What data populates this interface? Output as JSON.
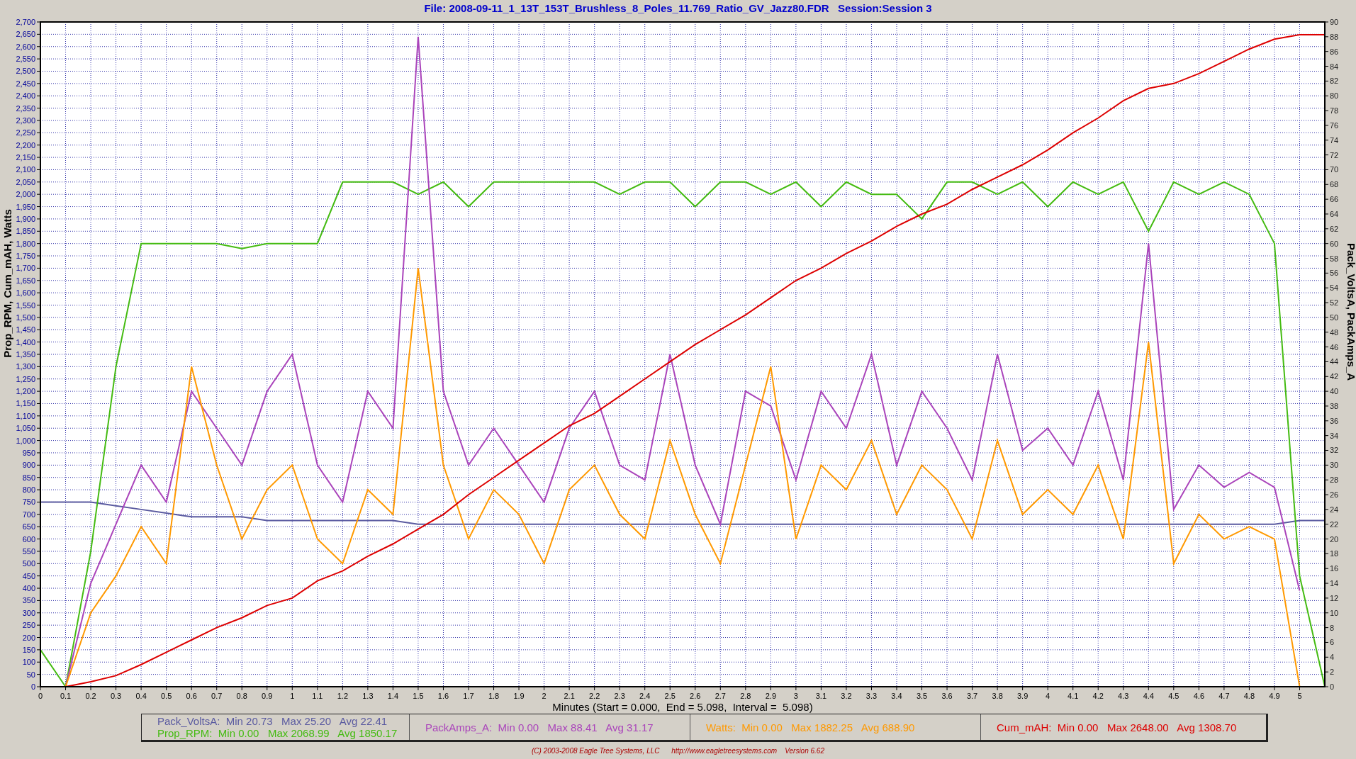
{
  "title": "File: 2008-09-11_1_13T_153T_Brushless_8_Poles_11.769_Ratio_GV_Jazz80.FDR   Session:Session 3",
  "chart": {
    "chart_data": {
      "type": "line",
      "xlabel": "Minutes (Start = 0.000,  End = 5.098,  Interval =  5.098)",
      "ylabel": "Prop_RPM, Cum_mAH, Watts",
      "y2label": "Pack_VoltsA, PackAmps_A",
      "x": [
        0,
        0.1,
        0.2,
        0.3,
        0.4,
        0.5,
        0.6,
        0.7,
        0.8,
        0.9,
        1,
        1.1,
        1.2,
        1.3,
        1.4,
        1.5,
        1.6,
        1.7,
        1.8,
        1.9,
        2,
        2.1,
        2.2,
        2.3,
        2.4,
        2.5,
        2.6,
        2.7,
        2.8,
        2.9,
        3,
        3.1,
        3.2,
        3.3,
        3.4,
        3.5,
        3.6,
        3.7,
        3.8,
        3.9,
        4,
        4.1,
        4.2,
        4.3,
        4.4,
        4.5,
        4.6,
        4.7,
        4.8,
        4.9,
        5,
        5.1
      ],
      "xlim": [
        0,
        5.1
      ],
      "grid": true,
      "ylim": [
        0,
        2700
      ],
      "y2lim": [
        0,
        90
      ],
      "series": [
        {
          "name": "Pack_VoltsA",
          "axis": "y2",
          "color": "#5a5aa0",
          "values": [
            25,
            25,
            25,
            24.5,
            24,
            23.5,
            23,
            23,
            23,
            22.5,
            22.5,
            22.5,
            22.5,
            22.5,
            22.5,
            22,
            22,
            22,
            22,
            22,
            22,
            22,
            22,
            22,
            22,
            22,
            22,
            22,
            22,
            22,
            22,
            22,
            22,
            22,
            22,
            22,
            22,
            22,
            22,
            22,
            22,
            22,
            22,
            22,
            22,
            22,
            22,
            22,
            22,
            22,
            22.5,
            22.5
          ]
        },
        {
          "name": "Prop_RPM",
          "color": "#44bb11",
          "values": [
            150,
            0,
            550,
            1300,
            1800,
            1800,
            1800,
            1800,
            1780,
            1800,
            1800,
            1800,
            2050,
            2050,
            2050,
            2000,
            2050,
            1950,
            2050,
            2050,
            2050,
            2050,
            2050,
            2000,
            2050,
            2050,
            1950,
            2050,
            2050,
            2000,
            2050,
            1950,
            2050,
            2000,
            2000,
            1900,
            2050,
            2050,
            2000,
            2050,
            1950,
            2050,
            2000,
            2050,
            1850,
            2050,
            2000,
            2050,
            2000,
            1800,
            450,
            0
          ]
        },
        {
          "name": "PackAmps_A",
          "axis": "y2",
          "color": "#aa44bb",
          "values": [
            null,
            0,
            14,
            22,
            30,
            25,
            40,
            35,
            30,
            40,
            45,
            30,
            25,
            40,
            35,
            88,
            40,
            30,
            35,
            30,
            25,
            35,
            40,
            30,
            28,
            45,
            30,
            22,
            40,
            38,
            28,
            40,
            35,
            45,
            30,
            40,
            35,
            28,
            45,
            32,
            35,
            30,
            40,
            28,
            60,
            24,
            30,
            27,
            29,
            27,
            13,
            null
          ]
        },
        {
          "name": "Watts",
          "color": "#ff9900",
          "values": [
            null,
            0,
            300,
            450,
            650,
            500,
            1300,
            900,
            600,
            800,
            900,
            600,
            500,
            800,
            700,
            1700,
            900,
            600,
            800,
            700,
            500,
            800,
            900,
            700,
            600,
            1000,
            700,
            500,
            900,
            1300,
            600,
            900,
            800,
            1000,
            700,
            900,
            800,
            600,
            1000,
            700,
            800,
            700,
            900,
            600,
            1400,
            500,
            700,
            600,
            650,
            600,
            0,
            null
          ]
        },
        {
          "name": "Cum_mAH",
          "color": "#dd0000",
          "values": [
            null,
            0,
            20,
            45,
            90,
            140,
            190,
            240,
            280,
            330,
            360,
            430,
            470,
            530,
            580,
            640,
            700,
            780,
            850,
            920,
            990,
            1060,
            1110,
            1180,
            1250,
            1320,
            1390,
            1450,
            1510,
            1580,
            1650,
            1700,
            1760,
            1810,
            1870,
            1920,
            1960,
            2020,
            2070,
            2120,
            2180,
            2250,
            2310,
            2380,
            2430,
            2450,
            2490,
            2540,
            2590,
            2630,
            2648,
            2648
          ]
        }
      ],
      "xticks": [
        0,
        0.1,
        0.2,
        0.3,
        0.4,
        0.5,
        0.6,
        0.7,
        0.8,
        0.9,
        1,
        1.1,
        1.2,
        1.3,
        1.4,
        1.5,
        1.6,
        1.7,
        1.8,
        1.9,
        2,
        2.1,
        2.2,
        2.3,
        2.4,
        2.5,
        2.6,
        2.7,
        2.8,
        2.9,
        3,
        3.1,
        3.2,
        3.3,
        3.4,
        3.5,
        3.6,
        3.7,
        3.8,
        3.9,
        4,
        4.1,
        4.2,
        4.3,
        4.4,
        4.5,
        4.6,
        4.7,
        4.8,
        4.9,
        5
      ],
      "yticks": [
        0,
        50,
        100,
        150,
        200,
        250,
        300,
        350,
        400,
        450,
        500,
        550,
        600,
        650,
        700,
        750,
        800,
        850,
        900,
        950,
        {
          "value": 1000,
          "label": "1,000"
        },
        {
          "value": 1050,
          "label": "1,050"
        },
        {
          "value": 1100,
          "label": "1,100"
        },
        {
          "value": 1150,
          "label": "1,150"
        },
        {
          "value": 1200,
          "label": "1,200"
        },
        {
          "value": 1250,
          "label": "1,250"
        },
        {
          "value": 1300,
          "label": "1,300"
        },
        {
          "value": 1350,
          "label": "1,350"
        },
        {
          "value": 1400,
          "label": "1,400"
        },
        {
          "value": 1450,
          "label": "1,450"
        },
        {
          "value": 1500,
          "label": "1,500"
        },
        {
          "value": 1550,
          "label": "1,550"
        },
        {
          "value": 1600,
          "label": "1,600"
        },
        {
          "value": 1650,
          "label": "1,650"
        },
        {
          "value": 1700,
          "label": "1,700"
        },
        {
          "value": 1750,
          "label": "1,750"
        },
        {
          "value": 1800,
          "label": "1,800"
        },
        {
          "value": 1850,
          "label": "1,850"
        },
        {
          "value": 1900,
          "label": "1,900"
        },
        {
          "value": 1950,
          "label": "1,950"
        },
        {
          "value": 2000,
          "label": "2,000"
        },
        {
          "value": 2050,
          "label": "2,050"
        },
        {
          "value": 2100,
          "label": "2,100"
        },
        {
          "value": 2150,
          "label": "2,150"
        },
        {
          "value": 2200,
          "label": "2,200"
        },
        {
          "value": 2250,
          "label": "2,250"
        },
        {
          "value": 2300,
          "label": "2,300"
        },
        {
          "value": 2350,
          "label": "2,350"
        },
        {
          "value": 2400,
          "label": "2,400"
        },
        {
          "value": 2450,
          "label": "2,450"
        },
        {
          "value": 2500,
          "label": "2,500"
        },
        {
          "value": 2550,
          "label": "2,550"
        },
        {
          "value": 2600,
          "label": "2,600"
        },
        {
          "value": 2650,
          "label": "2,650"
        },
        {
          "value": 2700,
          "label": "2,700"
        }
      ],
      "y2ticks": [
        0,
        2,
        4,
        6,
        8,
        10,
        12,
        14,
        16,
        18,
        20,
        22,
        24,
        26,
        28,
        30,
        32,
        34,
        36,
        38,
        40,
        42,
        44,
        46,
        48,
        50,
        52,
        54,
        56,
        58,
        60,
        62,
        64,
        66,
        68,
        70,
        72,
        74,
        76,
        78,
        80,
        82,
        84,
        86,
        88,
        90
      ]
    }
  },
  "legend": [
    [
      {
        "stats": ":  Min 20.73   Max 25.20   Avg 22.41"
      },
      {
        "stats": ":  Min 0.00   Max 2068.99   Avg 1850.17"
      }
    ],
    [
      {
        "stats": ":  Min 0.00   Max 88.41   Avg 31.17"
      }
    ],
    [
      {
        "stats": ":  Min 0.00   Max 1882.25   Avg 688.90"
      }
    ],
    [
      {
        "stats": ":  Min 0.00   Max 2648.00   Avg 1308.70"
      }
    ]
  ],
  "footer": "(C) 2003-2008 Eagle Tree Systems, LLC      http://www.eagletreesystems.com    Version 6.62"
}
